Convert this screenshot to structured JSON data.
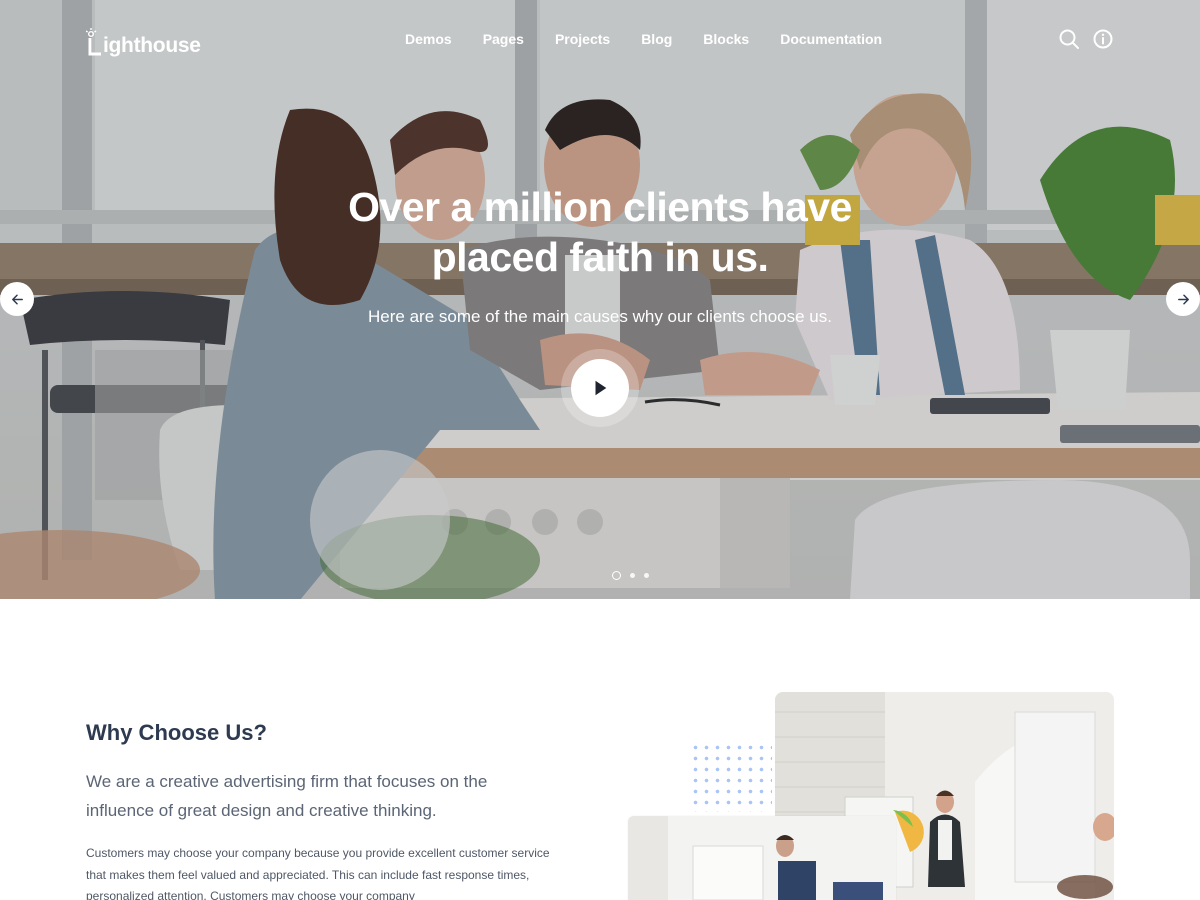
{
  "brand": {
    "logo_text": "ighthouse",
    "logo_letter": "L"
  },
  "nav": {
    "items": [
      "Demos",
      "Pages",
      "Projects",
      "Blog",
      "Blocks",
      "Documentation"
    ],
    "icons": [
      "search-icon",
      "info-icon"
    ]
  },
  "hero": {
    "title_line1": "Over a million clients have",
    "title_line2": "placed faith in us.",
    "subtitle": "Here are some of the main causes why our clients choose us.",
    "slides_total": 3,
    "active_slide": 1
  },
  "why": {
    "title": "Why Choose Us?",
    "lead": "We are a creative advertising firm that focuses on the influence of great design and creative thinking.",
    "body": "Customers may choose your company because you provide excellent customer service that makes them feel valued and appreciated. This can include fast response times, personalized attention. Customers may choose your company"
  },
  "colors": {
    "heading": "#2d3a4f",
    "text": "#5b6575",
    "dot_grid": "#a9c4f5",
    "white": "#ffffff"
  }
}
